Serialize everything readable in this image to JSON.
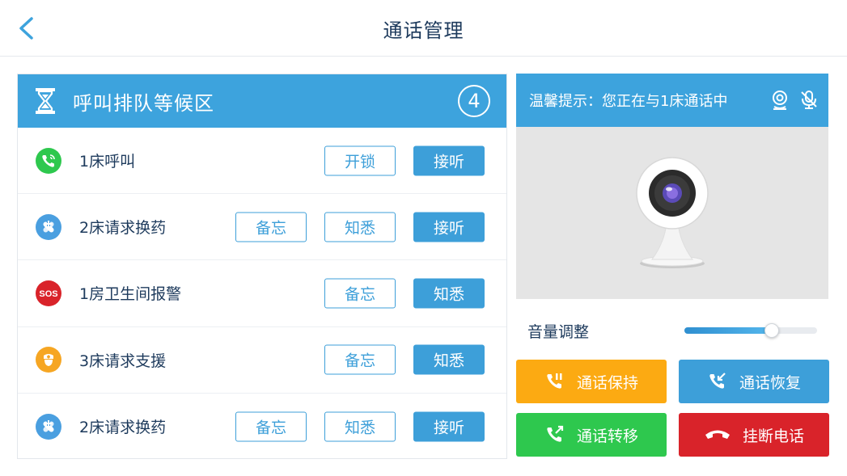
{
  "header": {
    "title": "通话管理"
  },
  "queue": {
    "title": "呼叫排队等候区",
    "count": "4",
    "rows": [
      {
        "label": "1床呼叫",
        "icon": "phone-call-icon",
        "icon_color": "#2ec84e",
        "buttons": [
          {
            "label": "开锁",
            "style": "outline"
          },
          {
            "label": "接听",
            "style": "solid"
          }
        ]
      },
      {
        "label": "2床请求换药",
        "icon": "medicine-exchange-icon",
        "icon_color": "#4a9fe0",
        "buttons": [
          {
            "label": "备忘",
            "style": "outline"
          },
          {
            "label": "知悉",
            "style": "outline"
          },
          {
            "label": "接听",
            "style": "solid"
          }
        ]
      },
      {
        "label": "1房卫生间报警",
        "icon": "sos-icon",
        "icon_color": "#d9232a",
        "buttons": [
          {
            "label": "备忘",
            "style": "outline"
          },
          {
            "label": "知悉",
            "style": "solid"
          }
        ]
      },
      {
        "label": "3床请求支援",
        "icon": "nurse-support-icon",
        "icon_color": "#f6a623",
        "buttons": [
          {
            "label": "备忘",
            "style": "outline"
          },
          {
            "label": "知悉",
            "style": "solid"
          }
        ]
      },
      {
        "label": "2床请求换药",
        "icon": "medicine-exchange-icon",
        "icon_color": "#4a9fe0",
        "buttons": [
          {
            "label": "备忘",
            "style": "outline"
          },
          {
            "label": "知悉",
            "style": "outline"
          },
          {
            "label": "接听",
            "style": "solid"
          }
        ]
      }
    ]
  },
  "call": {
    "tip": "温馨提示：您正在与1床通话中",
    "icons": [
      "camera-icon",
      "microphone-off-icon"
    ]
  },
  "volume": {
    "label": "音量调整",
    "level": 0.66
  },
  "actions": {
    "hold": "通话保持",
    "resume": "通话恢复",
    "transfer": "通话转移",
    "hangup": "挂断电话"
  },
  "colors": {
    "accent": "#3da3dd",
    "hold": "#fcaa12",
    "transfer": "#2ec84e",
    "hangup": "#d9232a"
  }
}
